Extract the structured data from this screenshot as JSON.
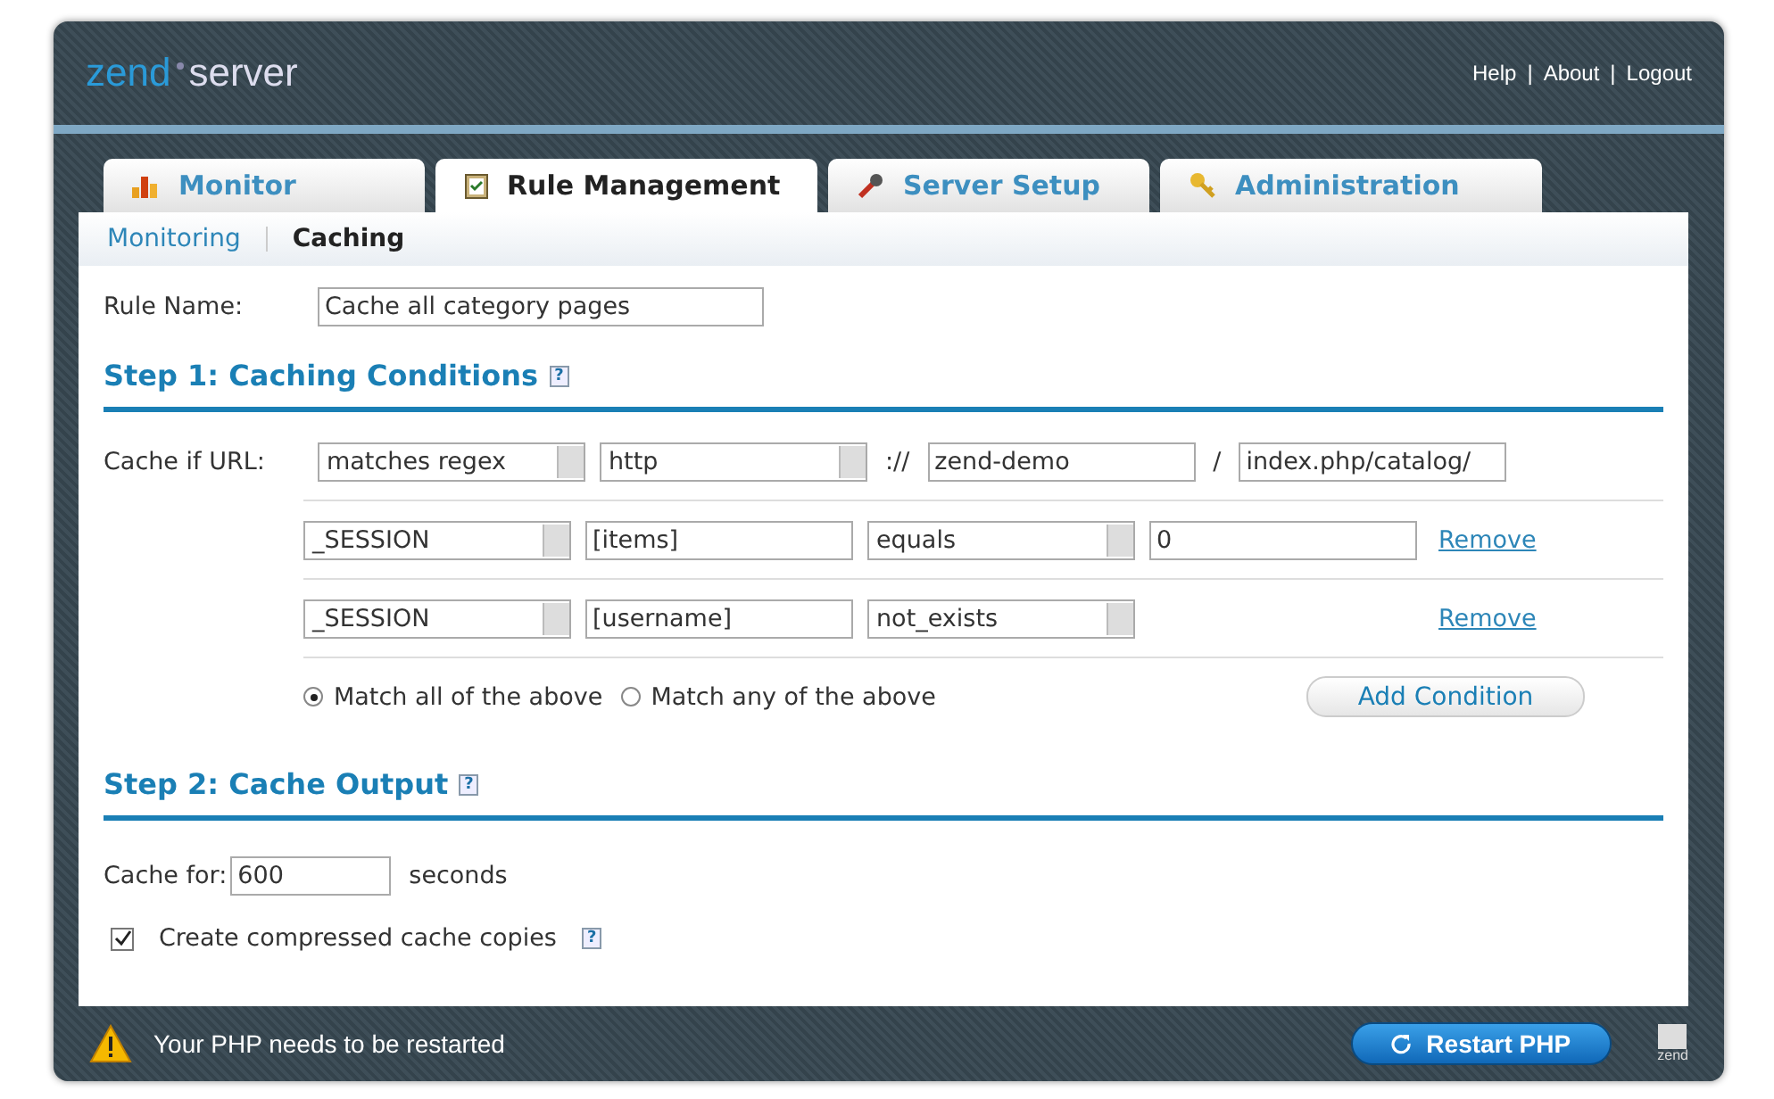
{
  "header": {
    "logo": [
      "zend",
      "server"
    ],
    "links": [
      "Help",
      "About",
      "Logout"
    ],
    "separator": "|"
  },
  "tabs": [
    {
      "label": "Monitor",
      "kind": "chart",
      "selected": false
    },
    {
      "label": "Rule Management",
      "kind": "clipboard",
      "selected": true
    },
    {
      "label": "Server Setup",
      "kind": "wrench",
      "selected": false
    },
    {
      "label": "Administration",
      "kind": "key",
      "selected": false
    }
  ],
  "subtabs": [
    {
      "label": "Monitoring",
      "selected": false
    },
    {
      "label": "Caching",
      "selected": true
    }
  ],
  "rule_name": {
    "label": "Rule Name:",
    "value": "Cache all category pages"
  },
  "step1": {
    "title": "Step 1: Caching Conditions",
    "help": "?"
  },
  "url_condition": {
    "label": "Cache if URL:",
    "match": "matches regex",
    "scheme": "http",
    "scheme_sep": "://",
    "host": "zend-demo",
    "path_sep": "/",
    "path": "index.php/catalog/"
  },
  "conditions": [
    {
      "source": "_SESSION",
      "key": "[items]",
      "operator": "equals",
      "value": "0",
      "remove": "Remove"
    },
    {
      "source": "_SESSION",
      "key": "[username]",
      "operator": "not_exists",
      "remove": "Remove"
    }
  ],
  "match_options": [
    {
      "label": "Match all of the above",
      "selected": true
    },
    {
      "label": "Match any of the above",
      "selected": false
    }
  ],
  "add_condition": "Add Condition",
  "step2": {
    "title": "Step 2: Cache Output",
    "help": "?"
  },
  "cache_for": {
    "label": "Cache for:",
    "value": "600",
    "unit": "seconds"
  },
  "compressed": {
    "label": "Create compressed cache copies",
    "checked": true,
    "help": "?"
  },
  "footer": {
    "message": "Your PHP needs to be restarted",
    "button": "Restart PHP",
    "logo": "zend"
  }
}
